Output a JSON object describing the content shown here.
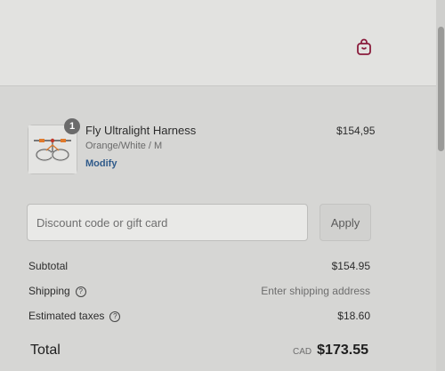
{
  "header": {
    "cart_icon": "shopping-bag-icon",
    "accent_color": "#8a1c3c"
  },
  "product": {
    "quantity": "1",
    "name": "Fly Ultralight Harness",
    "variant": "Orange/White / M",
    "modify_label": "Modify",
    "price": "$154,95"
  },
  "discount": {
    "placeholder": "Discount code or gift card",
    "apply_label": "Apply"
  },
  "summary": {
    "subtotal_label": "Subtotal",
    "subtotal_value": "$154.95",
    "shipping_label": "Shipping",
    "shipping_value": "Enter shipping address",
    "taxes_label": "Estimated taxes",
    "taxes_value": "$18.60",
    "help_icon": "question-circle-icon"
  },
  "total": {
    "label": "Total",
    "currency": "CAD",
    "value": "$173.55"
  }
}
